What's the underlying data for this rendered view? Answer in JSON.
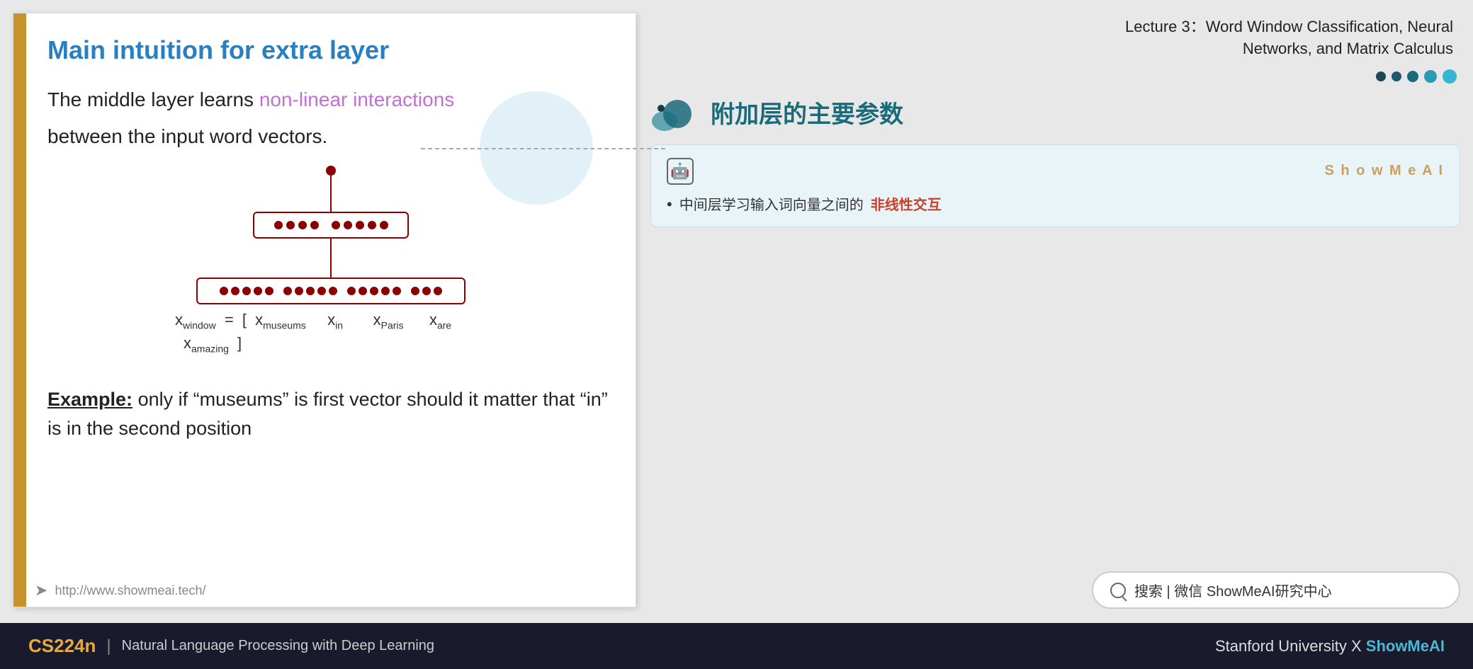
{
  "slide": {
    "left_bar_color": "#c8922a",
    "title": "Main intuition for extra layer",
    "body_text_prefix": "The middle layer learns ",
    "nonlinear_text": "non-linear interactions",
    "body_text_suffix": "between the input word vectors.",
    "url": "http://www.showmeai.tech/",
    "example_label": "Example:",
    "example_text": " only if “museums” is first vector should it matter that “in” is in the second position"
  },
  "equation": {
    "x_window": "x",
    "window_sub": "window",
    "equals": "= [",
    "x_museums": "x",
    "museums_sub": "museums",
    "x_in": "x",
    "in_sub": "in",
    "x_paris": "x",
    "paris_sub": "Paris",
    "x_are": "x",
    "are_sub": "are",
    "x_amazing": "x",
    "amazing_sub": "amazing",
    "bracket_close": "]"
  },
  "header": {
    "lecture_line1": "Lecture 3：Word Window Classification, Neural",
    "lecture_line2": "Networks, and Matrix Calculus"
  },
  "chinese_section": {
    "title": "附加层的主要参数",
    "card": {
      "showmeai_label": "S h o w M e A I",
      "bullet_prefix": "中间层学习输入词向量之间的",
      "nonlinear_chinese": "非线性交互"
    }
  },
  "search": {
    "text": "搜索 | 微信 ShowMeAI研究中心"
  },
  "footer": {
    "cs224n": "CS224n",
    "separator": "|",
    "subtitle": "Natural Language Processing with Deep Learning",
    "right_text": "Stanford University",
    "x_symbol": "X",
    "showmeai": "ShowMeAI"
  }
}
